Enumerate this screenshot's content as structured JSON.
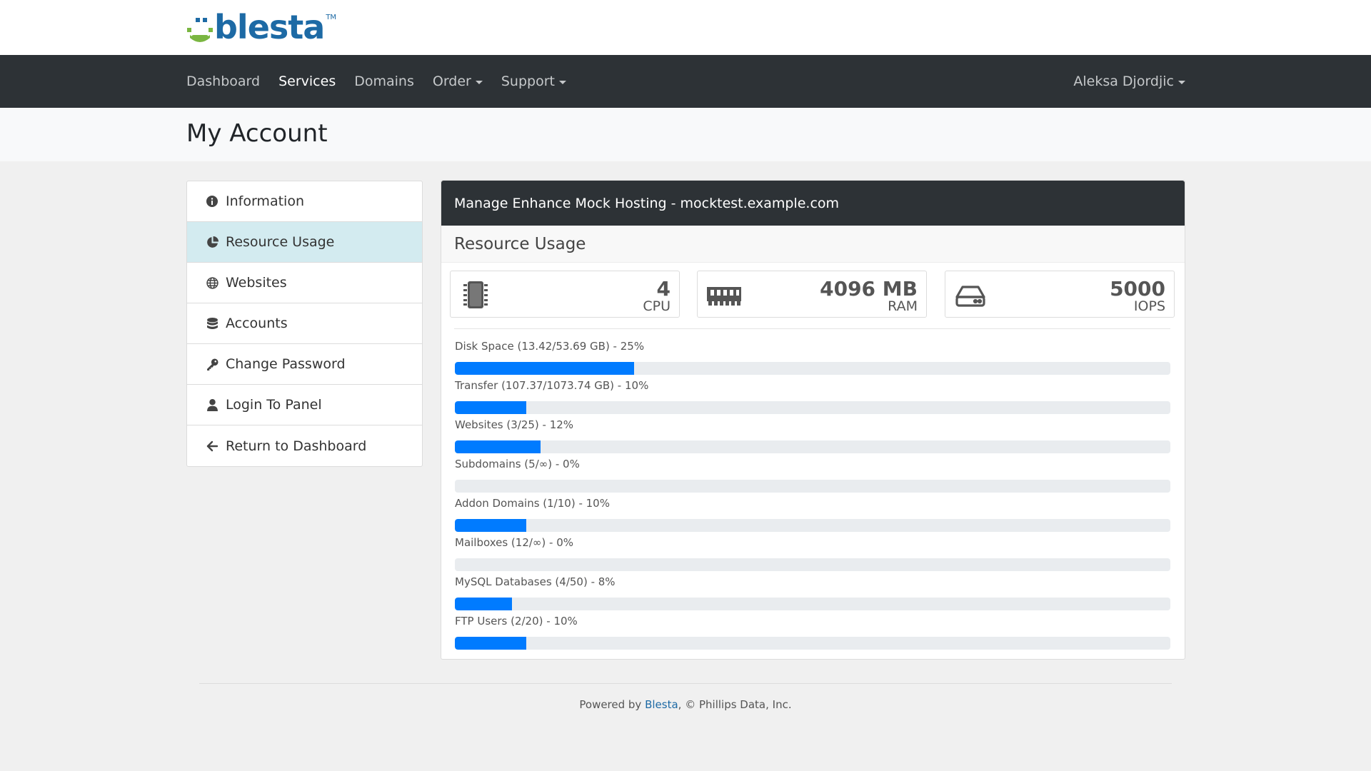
{
  "brand": {
    "name": "blesta",
    "tm": "TM",
    "text_color": "#1d6aa5",
    "mark_color": "#7ab641"
  },
  "nav": {
    "items": [
      {
        "label": "Dashboard",
        "active": false,
        "dropdown": false
      },
      {
        "label": "Services",
        "active": true,
        "dropdown": false
      },
      {
        "label": "Domains",
        "active": false,
        "dropdown": false
      },
      {
        "label": "Order",
        "active": false,
        "dropdown": true
      },
      {
        "label": "Support",
        "active": false,
        "dropdown": true
      }
    ],
    "user": "Aleksa Djordjic"
  },
  "page": {
    "title": "My Account"
  },
  "sidebar": {
    "items": [
      {
        "label": "Information",
        "icon": "info-icon",
        "active": false
      },
      {
        "label": "Resource Usage",
        "icon": "pie-chart-icon",
        "active": true
      },
      {
        "label": "Websites",
        "icon": "globe-icon",
        "active": false
      },
      {
        "label": "Accounts",
        "icon": "database-icon",
        "active": false
      },
      {
        "label": "Change Password",
        "icon": "key-icon",
        "active": false
      },
      {
        "label": "Login To Panel",
        "icon": "user-icon",
        "active": false
      },
      {
        "label": "Return to Dashboard",
        "icon": "arrow-left-icon",
        "active": false
      }
    ]
  },
  "panel": {
    "heading": "Manage Enhance Mock Hosting - mocktest.example.com",
    "subheading": "Resource Usage",
    "stats": [
      {
        "value": "4",
        "unit": "CPU",
        "icon": "cpu-chip-icon"
      },
      {
        "value": "4096 MB",
        "unit": "RAM",
        "icon": "memory-icon"
      },
      {
        "value": "5000",
        "unit": "IOPS",
        "icon": "hard-drive-icon"
      }
    ],
    "usage": [
      {
        "label": "Disk Space (13.42/53.69 GB) - 25%",
        "percent": 25
      },
      {
        "label": "Transfer (107.37/1073.74 GB) - 10%",
        "percent": 10
      },
      {
        "label": "Websites (3/25) - 12%",
        "percent": 12
      },
      {
        "label": "Subdomains (5/∞) - 0%",
        "percent": 0
      },
      {
        "label": "Addon Domains (1/10) - 10%",
        "percent": 10
      },
      {
        "label": "Mailboxes (12/∞) - 0%",
        "percent": 0
      },
      {
        "label": "MySQL Databases (4/50) - 8%",
        "percent": 8
      },
      {
        "label": "FTP Users (2/20) - 10%",
        "percent": 10
      }
    ],
    "bar_color": "#007bff"
  },
  "footer": {
    "prefix": "Powered by ",
    "link": "Blesta",
    "suffix": ", © Phillips Data, Inc."
  }
}
